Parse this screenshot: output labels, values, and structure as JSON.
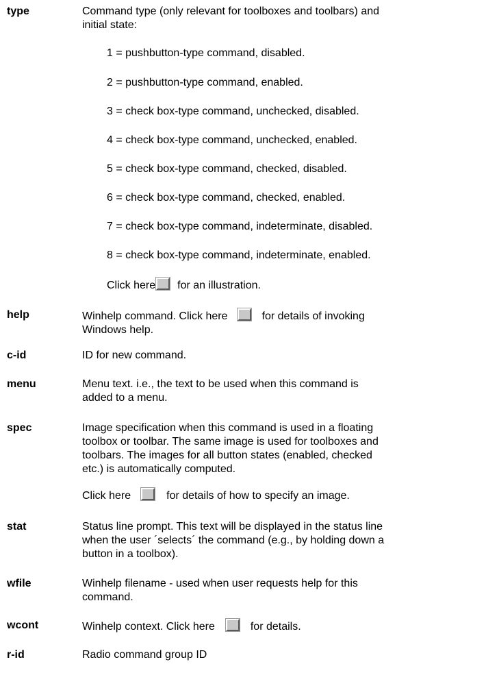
{
  "entries": {
    "type": {
      "term": "type",
      "desc_line1": "Command type (only relevant for toolboxes and toolbars) and",
      "desc_line2": "initial state:",
      "options": [
        "1 = pushbutton-type command, disabled.",
        "2 = pushbutton-type command, enabled.",
        "3 = check box-type command, unchecked, disabled.",
        "4 = check box-type command, unchecked, enabled.",
        "5 = check box-type command, checked, disabled.",
        "6 = check box-type command, checked, enabled.",
        "7 = check box-type command, indeterminate, disabled.",
        "8 = check box-type command, indeterminate, enabled."
      ],
      "click_before": "Click here",
      "click_after": "for an illustration."
    },
    "help": {
      "term": "help",
      "before": "Winhelp command. Click here",
      "after": "for details of invoking",
      "line2": "Windows help."
    },
    "c_id": {
      "term": "c-id",
      "desc": "ID for new command."
    },
    "menu": {
      "term": "menu",
      "line1": "Menu text. i.e., the text to be used when this command is",
      "line2": "added to a menu."
    },
    "spec": {
      "term": "spec",
      "line1": "Image specification when this command is used in a floating",
      "line2": "toolbox or toolbar. The same image is used for toolboxes and",
      "line3": "toolbars. The images for all button states (enabled, checked",
      "line4": "etc.) is automatically computed.",
      "click_before": "Click here",
      "click_after": "for details of how to specify an image."
    },
    "stat": {
      "term": "stat",
      "line1": "Status line prompt. This text will be displayed in the status line",
      "line2": "when the user ´selects´ the command (e.g., by holding down a",
      "line3": "button in a toolbox)."
    },
    "wfile": {
      "term": "wfile",
      "line1": "Winhelp filename - used when user requests help for this",
      "line2": "command."
    },
    "wcont": {
      "term": "wcont",
      "before": "Winhelp context. Click here",
      "after": "for details."
    },
    "r_id": {
      "term": "r-id",
      "desc": "Radio command group ID"
    }
  }
}
